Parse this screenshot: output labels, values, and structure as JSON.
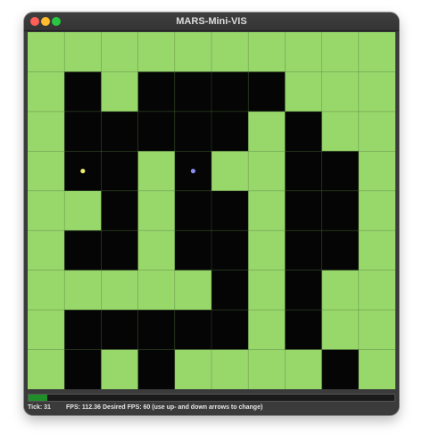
{
  "window": {
    "title": "MARS-Mini-VIS",
    "buttons": [
      {
        "name": "close-button",
        "color": "#ff5f57"
      },
      {
        "name": "minimize-button",
        "color": "#febc2e"
      },
      {
        "name": "zoom-button",
        "color": "#28c840"
      }
    ]
  },
  "world": {
    "cols": 10,
    "rows": 9,
    "floor_color": "#98d86b",
    "wall_color": "#050505",
    "gridline_color": "#4a6a3a",
    "walls": [
      [
        1,
        1
      ],
      [
        3,
        1
      ],
      [
        4,
        1
      ],
      [
        5,
        1
      ],
      [
        6,
        1
      ],
      [
        1,
        2
      ],
      [
        2,
        2
      ],
      [
        3,
        2
      ],
      [
        4,
        2
      ],
      [
        5,
        2
      ],
      [
        7,
        2
      ],
      [
        1,
        3
      ],
      [
        2,
        3
      ],
      [
        4,
        3
      ],
      [
        7,
        3
      ],
      [
        8,
        3
      ],
      [
        2,
        4
      ],
      [
        4,
        4
      ],
      [
        5,
        4
      ],
      [
        7,
        4
      ],
      [
        8,
        4
      ],
      [
        1,
        5
      ],
      [
        2,
        5
      ],
      [
        4,
        5
      ],
      [
        5,
        5
      ],
      [
        7,
        5
      ],
      [
        8,
        5
      ],
      [
        5,
        6
      ],
      [
        7,
        6
      ],
      [
        1,
        7
      ],
      [
        2,
        7
      ],
      [
        3,
        7
      ],
      [
        4,
        7
      ],
      [
        5,
        7
      ],
      [
        7,
        7
      ],
      [
        1,
        8
      ],
      [
        3,
        8
      ],
      [
        8,
        8
      ]
    ],
    "agents": [
      {
        "col": 1,
        "row": 3,
        "color": "#ecec6a"
      },
      {
        "col": 4,
        "row": 3,
        "color": "#8c8cf0"
      }
    ]
  },
  "status": {
    "progress_fraction": 0.05,
    "progress_color": "#1f8f2a",
    "tick": "Tick: 31",
    "fps": "FPS: 112.36",
    "desired_fps": "Desired FPS: 60 (use up- and down arrows to change)"
  }
}
